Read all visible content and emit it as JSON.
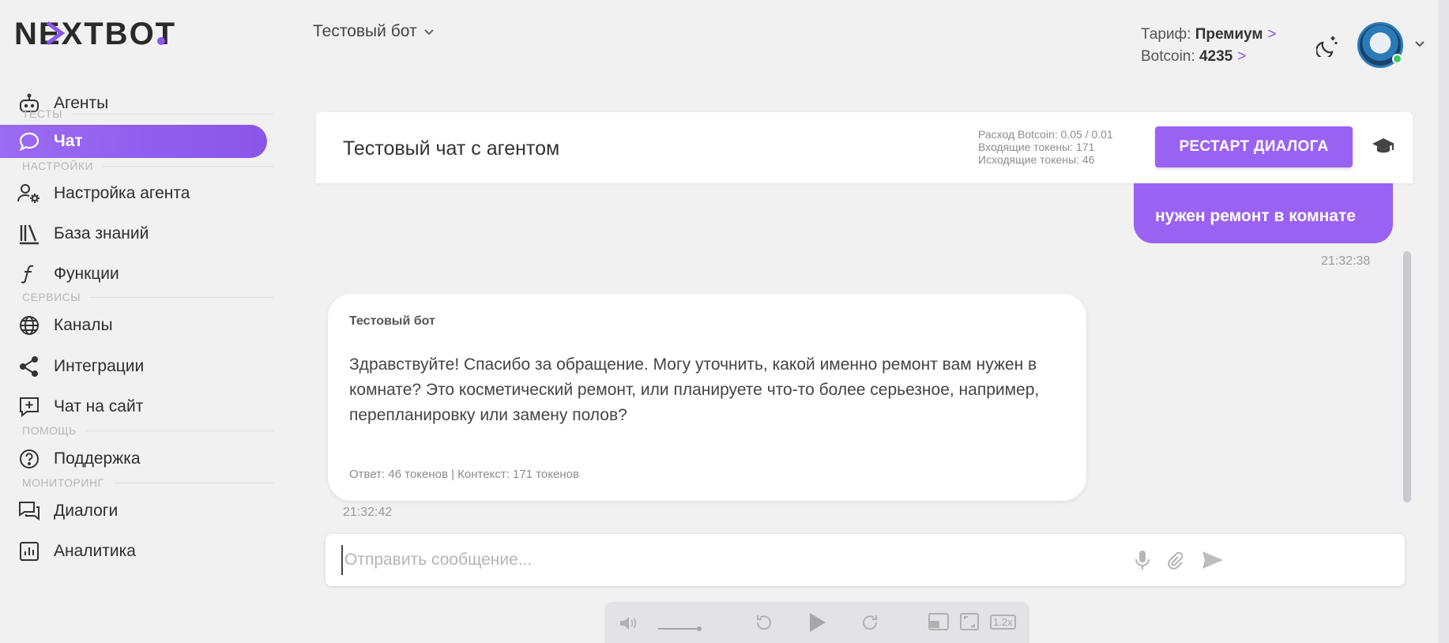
{
  "brand": {
    "logo_text": "NEXTBOT"
  },
  "topbar": {
    "bot_name": "Тестовый бот",
    "tariff_label": "Тариф:",
    "tariff_value": "Премиум",
    "botcoin_label": "Botcoin:",
    "botcoin_value": "4235",
    "chevron": ">"
  },
  "sidebar": {
    "agents": "Агенты",
    "section_tests": "ТЕСТЫ",
    "chat": "Чат",
    "section_settings": "НАСТРОЙКИ",
    "agent_settings": "Настройка агента",
    "knowledge_base": "База знаний",
    "functions": "Функции",
    "section_services": "СЕРВИСЫ",
    "channels": "Каналы",
    "integrations": "Интеграции",
    "site_chat": "Чат на сайт",
    "section_help": "ПОМОЩЬ",
    "support": "Поддержка",
    "section_monitoring": "МОНИТОРИНГ",
    "dialogs": "Диалоги",
    "analytics": "Аналитика"
  },
  "chat_panel": {
    "title": "Тестовый чат с агентом",
    "stats_cost": "Расход Botcoin: 0.05 / 0.01",
    "stats_in": "Входящие токены: 171",
    "stats_out": "Исходящие токены: 46",
    "restart_button": "РЕСТАРТ ДИАЛОГА"
  },
  "messages": {
    "user_text": "нужен ремонт в комнате",
    "user_time": "21:32:38",
    "bot_name": "Тестовый бот",
    "bot_text": "Здравствуйте! Спасибо за обращение. Могу уточнить, какой именно ремонт вам нужен в комнате? Это косметический ремонт, или планируете что-то более серьезное, например, перепланировку или замену полов?",
    "bot_meta": "Ответ: 46 токенов | Контекст: 171 токенов",
    "bot_time": "21:32:42"
  },
  "composer": {
    "placeholder": "Отправить сообщение..."
  },
  "video_bar": {
    "speed": "1.2x"
  },
  "colors": {
    "accent": "#9a62f3",
    "online": "#3ac75f"
  }
}
